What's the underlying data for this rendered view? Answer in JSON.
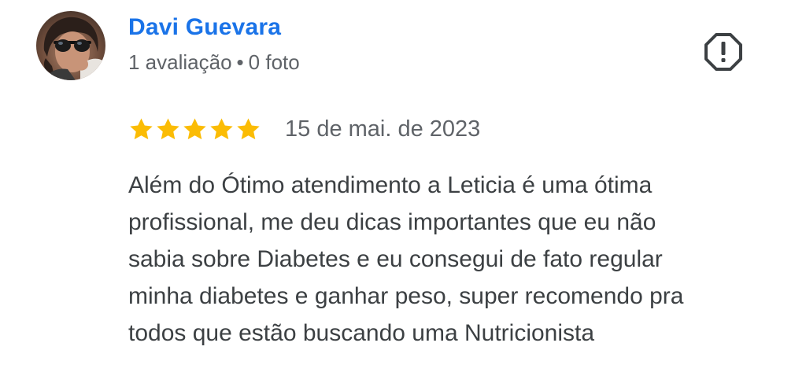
{
  "review": {
    "author": {
      "name": "Davi Guevara",
      "review_count": "1 avaliação",
      "separator": "•",
      "photo_count": "0 foto",
      "avatar": "user-avatar-photo"
    },
    "report_icon": "flag-report-icon",
    "rating": {
      "stars": 5,
      "max_stars": 5,
      "star_color": "#fbbc04"
    },
    "date": "15 de mai. de 2023",
    "text_lines": [
      "Além do Ótimo atendimento a Leticia é uma ótima",
      "profissional, me deu dicas importantes que eu não",
      "sabia sobre Diabetes e eu consegui de fato regular",
      "minha diabetes e ganhar peso, super recomendo pra",
      "todos que estão buscando uma Nutricionista"
    ]
  },
  "colors": {
    "name": "#1a73e8",
    "meta": "#5f6368",
    "body": "#3c4043",
    "icon": "#3c4043"
  }
}
